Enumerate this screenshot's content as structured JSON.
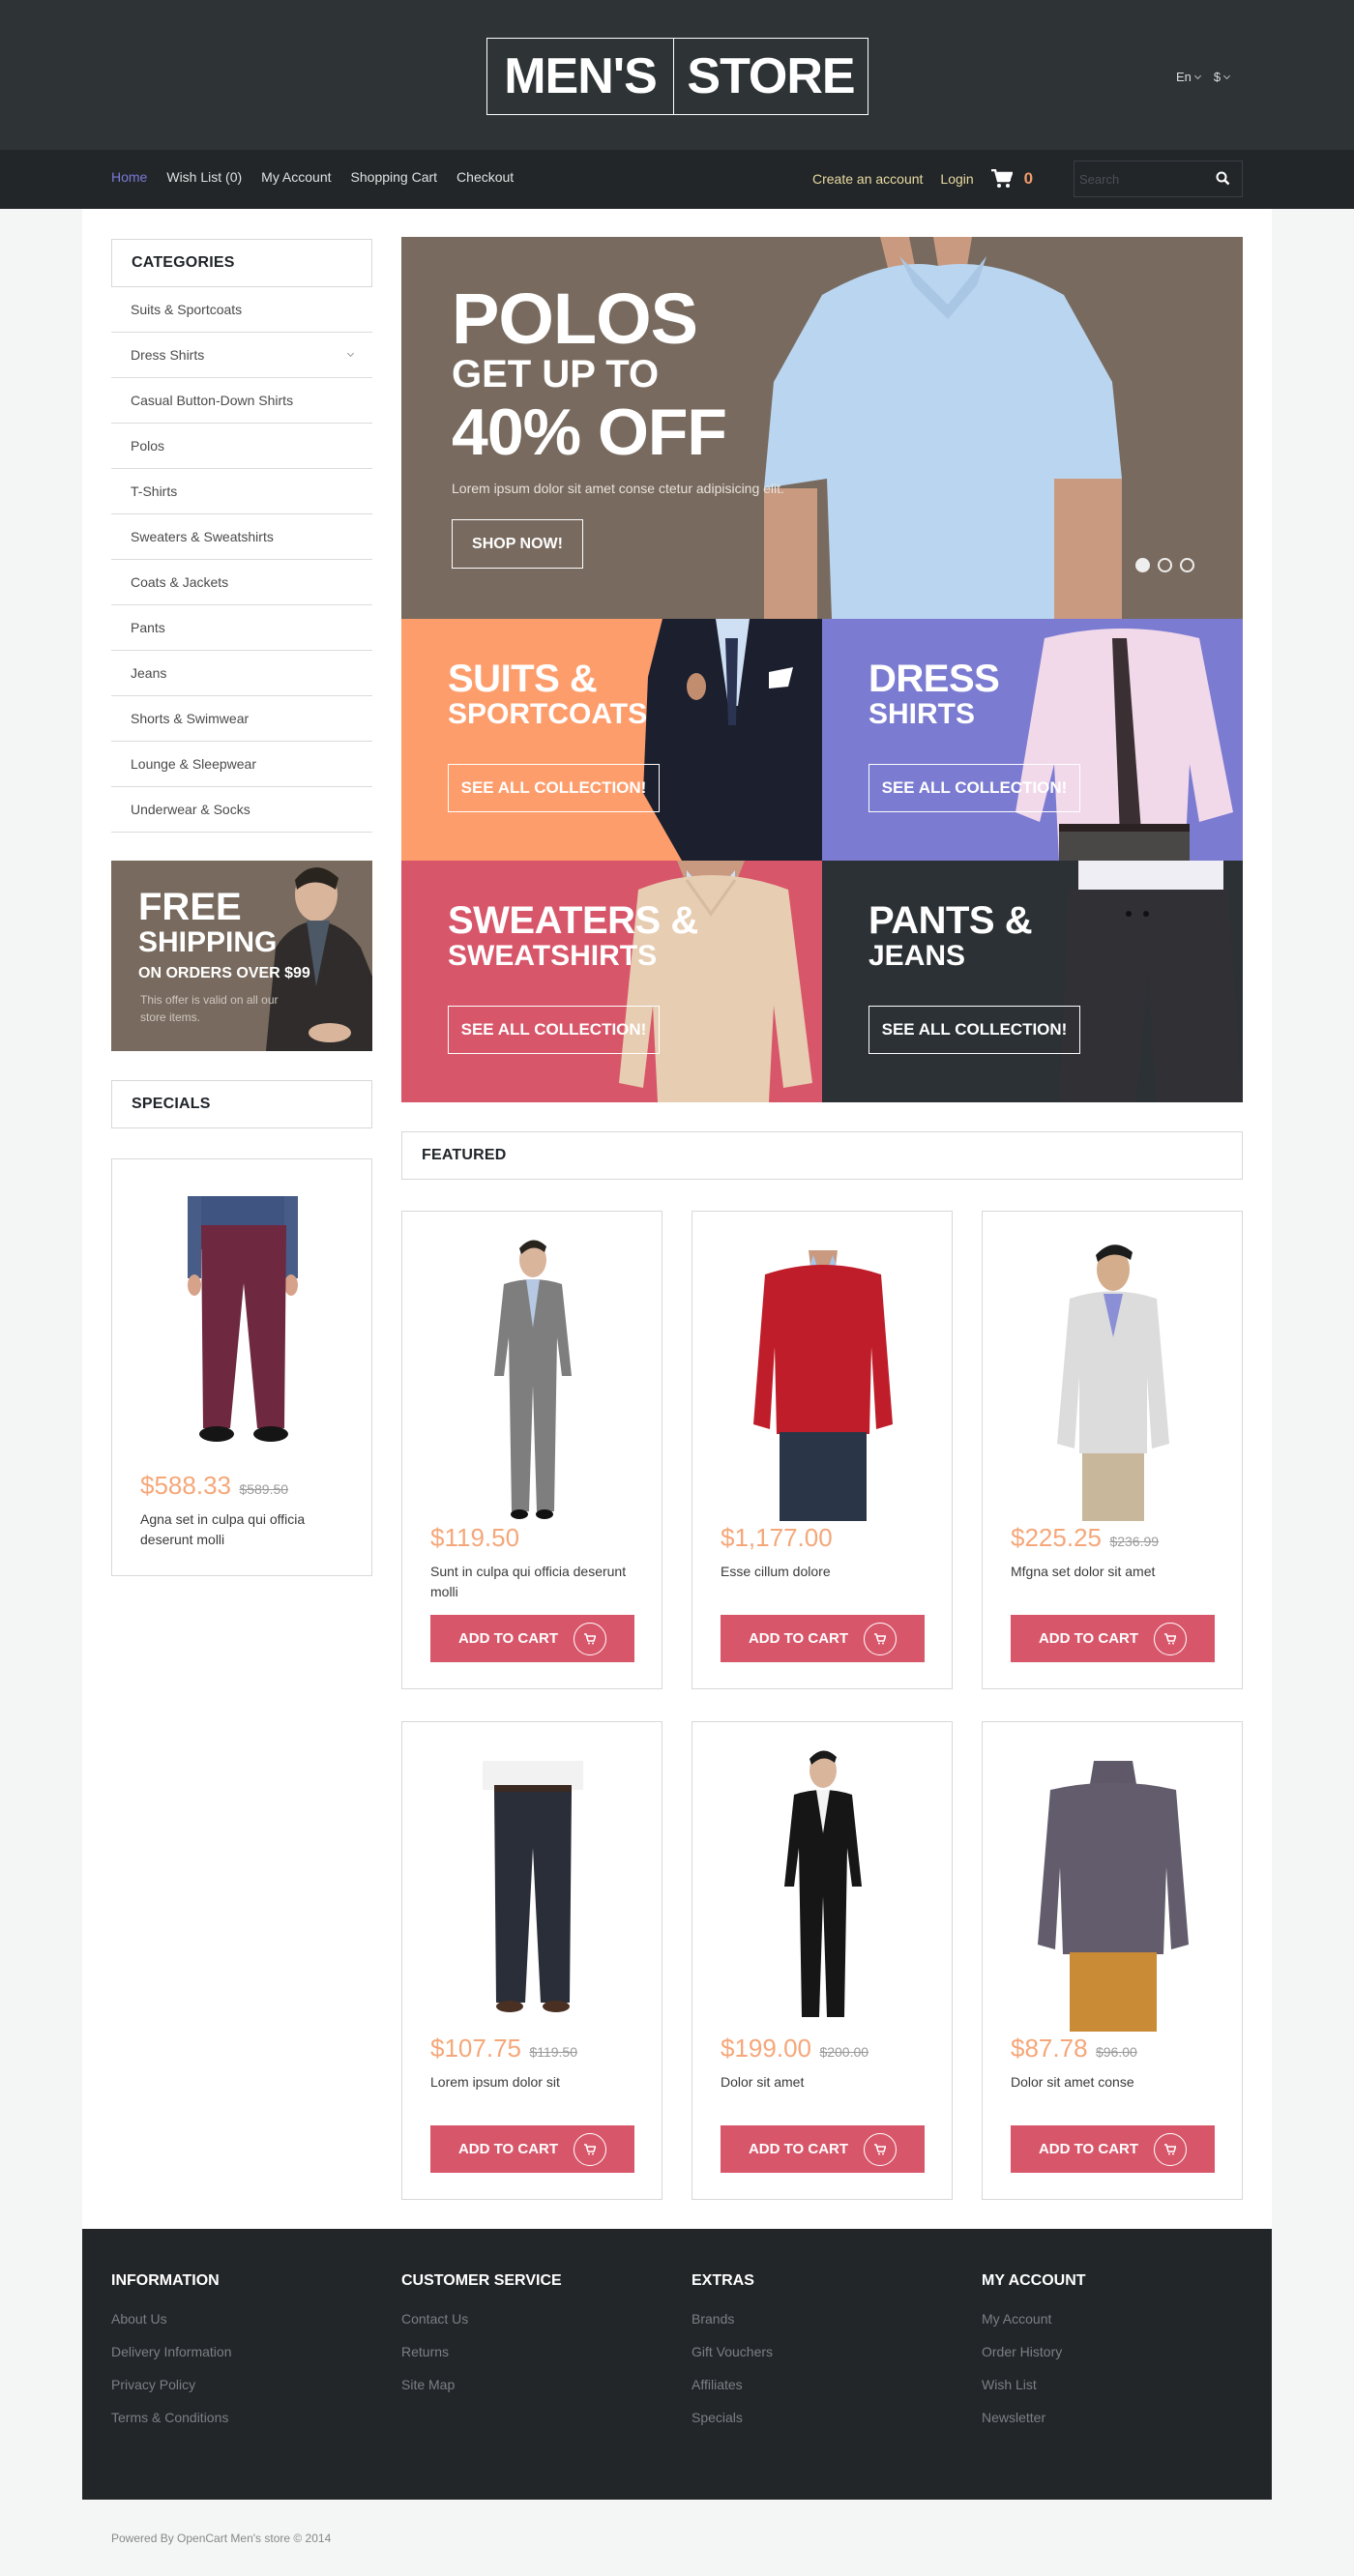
{
  "header": {
    "logo_part1": "MEN'S",
    "logo_part2": "STORE",
    "language": "En",
    "currency": "$"
  },
  "nav": {
    "links": [
      "Home",
      "Wish List (0)",
      "My Account",
      "Shopping Cart",
      "Checkout"
    ],
    "active": "Home",
    "create_account": "Create an account",
    "login": "Login",
    "cart_count": "0",
    "search_placeholder": "Search"
  },
  "sidebar": {
    "categories_title": "CATEGORIES",
    "categories": [
      {
        "label": "Suits & Sportcoats",
        "has_children": false
      },
      {
        "label": "Dress Shirts",
        "has_children": true
      },
      {
        "label": "Casual Button-Down Shirts",
        "has_children": false
      },
      {
        "label": "Polos",
        "has_children": false
      },
      {
        "label": "T-Shirts",
        "has_children": false
      },
      {
        "label": "Sweaters & Sweatshirts",
        "has_children": false
      },
      {
        "label": "Coats & Jackets",
        "has_children": false
      },
      {
        "label": "Pants",
        "has_children": false
      },
      {
        "label": "Jeans",
        "has_children": false
      },
      {
        "label": "Shorts & Swimwear",
        "has_children": false
      },
      {
        "label": "Lounge & Sleepwear",
        "has_children": false
      },
      {
        "label": "Underwear & Socks",
        "has_children": false
      }
    ],
    "shipping_banner": {
      "line1": "FREE",
      "line2": "SHIPPING",
      "line3": "ON ORDERS OVER $99",
      "line4": "This offer is valid on all our store items."
    },
    "specials_title": "SPECIALS",
    "special_product": {
      "price": "$588.33",
      "old_price": "$589.50",
      "name": "Agna set in culpa qui officia deserunt molli",
      "image": "burgundy-pants"
    }
  },
  "hero": {
    "line1": "POLOS",
    "line2": "GET UP TO",
    "line3": "40% OFF",
    "text": "Lorem ipsum dolor sit amet conse ctetur adipisicing elit.",
    "button": "SHOP NOW!",
    "slides": 3,
    "active_slide": 1
  },
  "tiles": [
    {
      "line1": "SUITS &",
      "line2": "SPORTCOATS",
      "button": "SEE ALL COLLECTION!",
      "color": "#fe9d6c"
    },
    {
      "line1": "DRESS",
      "line2": "SHIRTS",
      "button": "SEE ALL COLLECTION!",
      "color": "#7b7bd2"
    },
    {
      "line1": "SWEATERS &",
      "line2": "SWEATSHIRTS",
      "button": "SEE ALL COLLECTION!",
      "color": "#d8566a"
    },
    {
      "line1": "PANTS &",
      "line2": "JEANS",
      "button": "SEE ALL COLLECTION!",
      "color": "#2b3135"
    }
  ],
  "featured": {
    "title": "FEATURED",
    "add_to_cart": "ADD TO CART",
    "products": [
      {
        "price": "$119.50",
        "old_price": "",
        "name": "Sunt in culpa qui officia deserunt molli",
        "image": "grey-suit"
      },
      {
        "price": "$1,177.00",
        "old_price": "",
        "name": "Esse cillum dolore",
        "image": "red-sweater"
      },
      {
        "price": "$225.25",
        "old_price": "$236.99",
        "name": "Mfgna set dolor sit amet",
        "image": "grey-hoodie"
      },
      {
        "price": "$107.75",
        "old_price": "$119.50",
        "name": "Lorem ipsum dolor sit",
        "image": "dark-trousers"
      },
      {
        "price": "$199.00",
        "old_price": "$200.00",
        "name": "Dolor sit amet",
        "image": "black-tuxedo"
      },
      {
        "price": "$87.78",
        "old_price": "$96.00",
        "name": "Dolor sit amet conse",
        "image": "purple-pullover"
      }
    ]
  },
  "footer": {
    "columns": [
      {
        "title": "INFORMATION",
        "links": [
          "About Us",
          "Delivery Information",
          "Privacy Policy",
          "Terms & Conditions"
        ]
      },
      {
        "title": "CUSTOMER SERVICE",
        "links": [
          "Contact Us",
          "Returns",
          "Site Map"
        ]
      },
      {
        "title": "EXTRAS",
        "links": [
          "Brands",
          "Gift Vouchers",
          "Affiliates",
          "Specials"
        ]
      },
      {
        "title": "MY ACCOUNT",
        "links": [
          "My Account",
          "Order History",
          "Wish List",
          "Newsletter"
        ]
      }
    ],
    "copyright": "Powered By OpenCart Men's store © 2014"
  },
  "colors": {
    "header_bg": "#2e3336",
    "nav_bg": "#222629",
    "accent_link": "#7a79d6",
    "price": "#f5a77a",
    "cart_button": "#d8566a",
    "hero_bg": "#786a5e"
  }
}
